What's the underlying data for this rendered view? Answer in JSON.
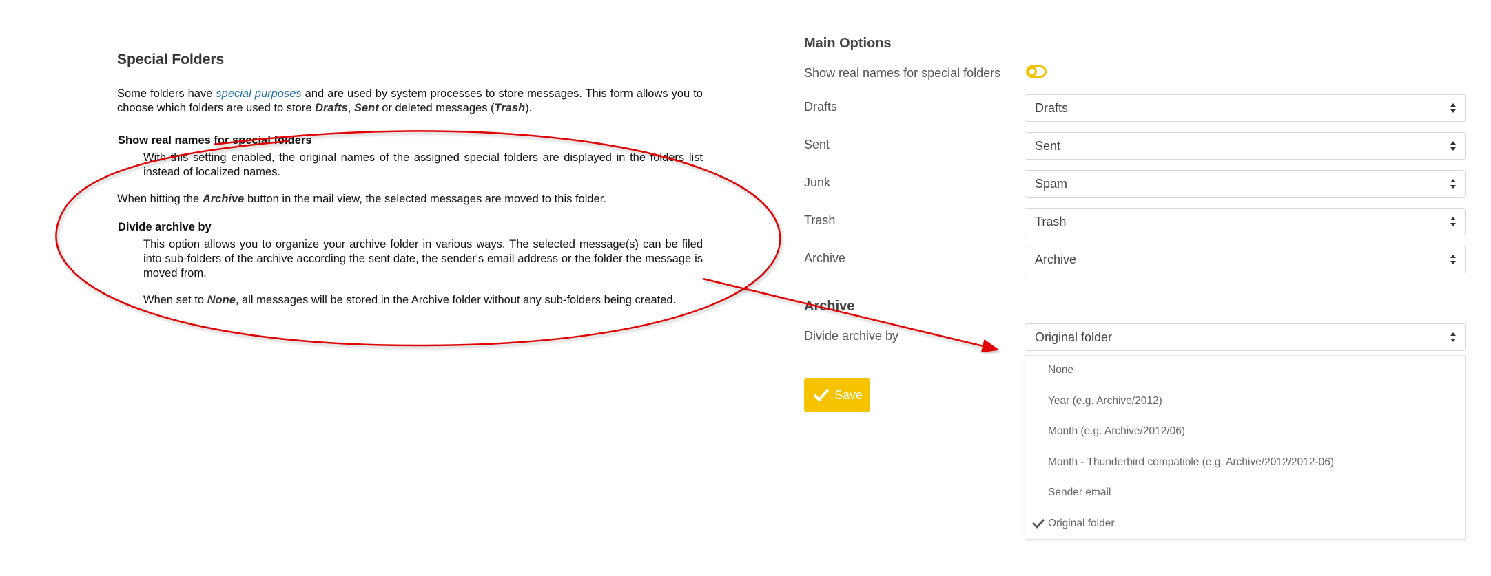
{
  "help": {
    "title": "Special Folders",
    "intro": {
      "pre": "Some folders have ",
      "link": "special purposes",
      "mid1": " and are used by system processes to store messages. This form allows you to choose which folders are used to store ",
      "drafts": "Drafts",
      "comma": ", ",
      "sent": "Sent",
      "mid2": " or deleted messages (",
      "trash": "Trash",
      "end": ")."
    },
    "show_real_names": {
      "title": "Show real names for special folders",
      "body": "With this setting enabled, the original names of the assigned special folders are displayed in the folders list instead of localized names."
    },
    "archive_line": {
      "pre": "When hitting the ",
      "word": "Archive",
      "post": " button in the mail view, the selected messages are moved to this folder."
    },
    "divide": {
      "title": "Divide archive by",
      "body": "This option allows you to organize your archive folder in various ways. The selected message(s) can be filed into sub-folders of the archive according the sent date, the sender's email address or the folder the message is moved from.",
      "note_pre": "When set to ",
      "note_word": "None",
      "note_post": ", all messages will be stored in the Archive folder without any sub-folders being created."
    }
  },
  "form": {
    "main_title": "Main Options",
    "show_real_names_label": "Show real names for special folders",
    "toggle_state": "off",
    "rows": [
      {
        "label": "Drafts",
        "value": "Drafts"
      },
      {
        "label": "Sent",
        "value": "Sent"
      },
      {
        "label": "Junk",
        "value": "Spam"
      },
      {
        "label": "Trash",
        "value": "Trash"
      },
      {
        "label": "Archive",
        "value": "Archive"
      }
    ],
    "archive_title": "Archive",
    "divide_label": "Divide archive by",
    "divide_value": "Original folder",
    "save_label": "Save",
    "options": [
      "None",
      "Year (e.g. Archive/2012)",
      "Month (e.g. Archive/2012/06)",
      "Month - Thunderbird compatible (e.g. Archive/2012/2012-06)",
      "Sender email",
      "Original folder"
    ],
    "selected_option": "Original folder"
  },
  "colors": {
    "accent": "#f6c300",
    "annotation": "#e00000",
    "link": "#1f6fa8"
  }
}
